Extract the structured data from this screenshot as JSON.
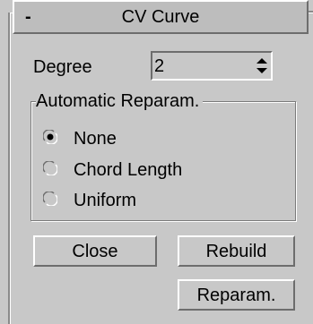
{
  "rollout": {
    "collapse_symbol": "-",
    "title": "CV Curve"
  },
  "degree": {
    "label": "Degree",
    "value": "2"
  },
  "reparam_group": {
    "legend": "Automatic Reparam.",
    "options": [
      {
        "label": "None",
        "selected": true
      },
      {
        "label": "Chord Length",
        "selected": false
      },
      {
        "label": "Uniform",
        "selected": false
      }
    ]
  },
  "buttons": {
    "close": "Close",
    "rebuild": "Rebuild",
    "reparam": "Reparam."
  },
  "icons": {
    "collapse": "minus-icon",
    "spinner": "spinner-arrows-icon",
    "radio_selected": "radio-selected-icon",
    "radio_unselected": "radio-unselected-icon"
  },
  "colors": {
    "panel_bg": "#c8c8c8",
    "header_bg": "#bdbdbd",
    "highlight": "#ffffff",
    "shadow": "#6d6d6d",
    "text": "#000000"
  }
}
